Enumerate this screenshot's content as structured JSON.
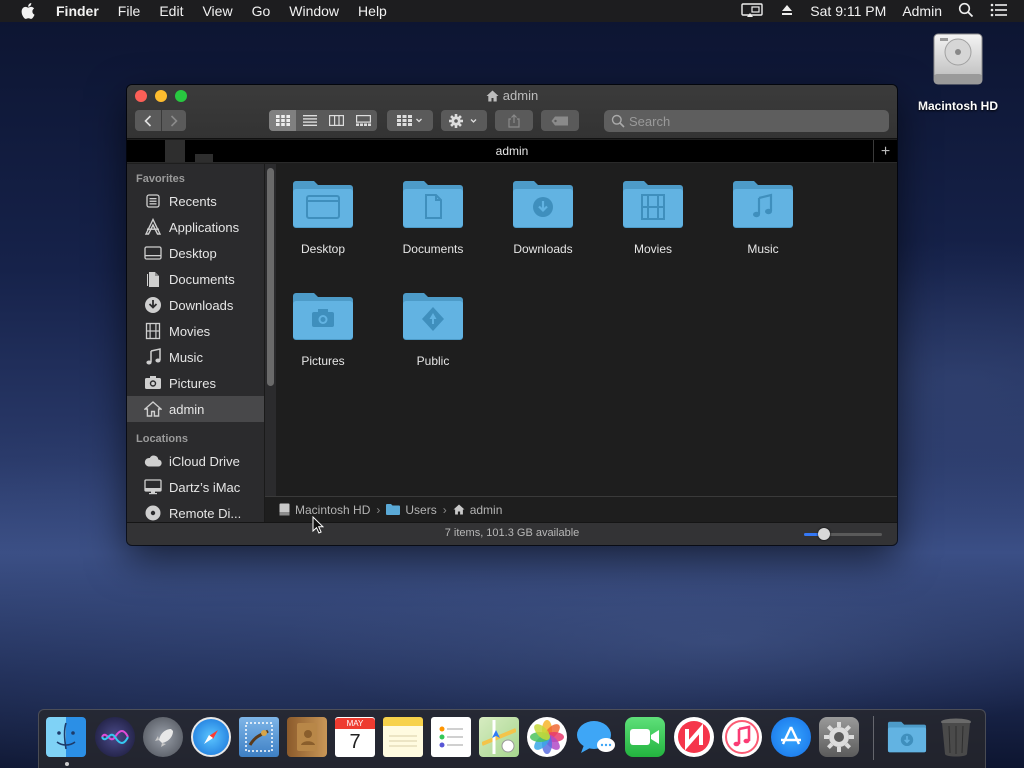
{
  "menubar": {
    "app": "Finder",
    "items": [
      "File",
      "Edit",
      "View",
      "Go",
      "Window",
      "Help"
    ],
    "clock": "Sat 9:11 PM",
    "user": "Admin"
  },
  "desktop": {
    "hd_label": "Macintosh HD"
  },
  "window": {
    "title": "admin",
    "tab_label": "admin",
    "search_placeholder": "Search",
    "sidebar": {
      "favorites_heading": "Favorites",
      "favorites": [
        {
          "label": "Recents",
          "icon": "recents-icon"
        },
        {
          "label": "Applications",
          "icon": "applications-icon"
        },
        {
          "label": "Desktop",
          "icon": "desktop-icon"
        },
        {
          "label": "Documents",
          "icon": "documents-icon"
        },
        {
          "label": "Downloads",
          "icon": "downloads-icon"
        },
        {
          "label": "Movies",
          "icon": "movies-icon"
        },
        {
          "label": "Music",
          "icon": "music-icon"
        },
        {
          "label": "Pictures",
          "icon": "pictures-icon"
        },
        {
          "label": "admin",
          "icon": "home-icon"
        }
      ],
      "locations_heading": "Locations",
      "locations": [
        {
          "label": "iCloud Drive",
          "icon": "cloud-icon"
        },
        {
          "label": "Dartz’s iMac",
          "icon": "imac-icon"
        },
        {
          "label": "Remote Di...",
          "icon": "remote-disc-icon"
        }
      ]
    },
    "folders": [
      {
        "label": "Desktop",
        "icon": "desktop-folder-icon"
      },
      {
        "label": "Documents",
        "icon": "documents-folder-icon"
      },
      {
        "label": "Downloads",
        "icon": "downloads-folder-icon"
      },
      {
        "label": "Movies",
        "icon": "movies-folder-icon"
      },
      {
        "label": "Music",
        "icon": "music-folder-icon"
      },
      {
        "label": "Pictures",
        "icon": "pictures-folder-icon"
      },
      {
        "label": "Public",
        "icon": "public-folder-icon"
      }
    ],
    "path": [
      "Macintosh HD",
      "Users",
      "admin"
    ],
    "status": "7 items, 101.3 GB available",
    "icon_size_level": 0.25
  },
  "dock": {
    "apps": [
      "Finder",
      "Siri",
      "Launchpad",
      "Safari",
      "Mail",
      "Contacts",
      "Calendar",
      "Notes",
      "Reminders",
      "Maps",
      "Photos",
      "Messages",
      "FaceTime",
      "News",
      "iTunes",
      "App Store",
      "System Preferences",
      "Downloads",
      "Trash"
    ],
    "calendar_month": "MAY",
    "calendar_day": "7"
  },
  "colors": {
    "folder": "#5aa9d6",
    "accent": "#3478f6",
    "selected_row": "#48484a"
  }
}
